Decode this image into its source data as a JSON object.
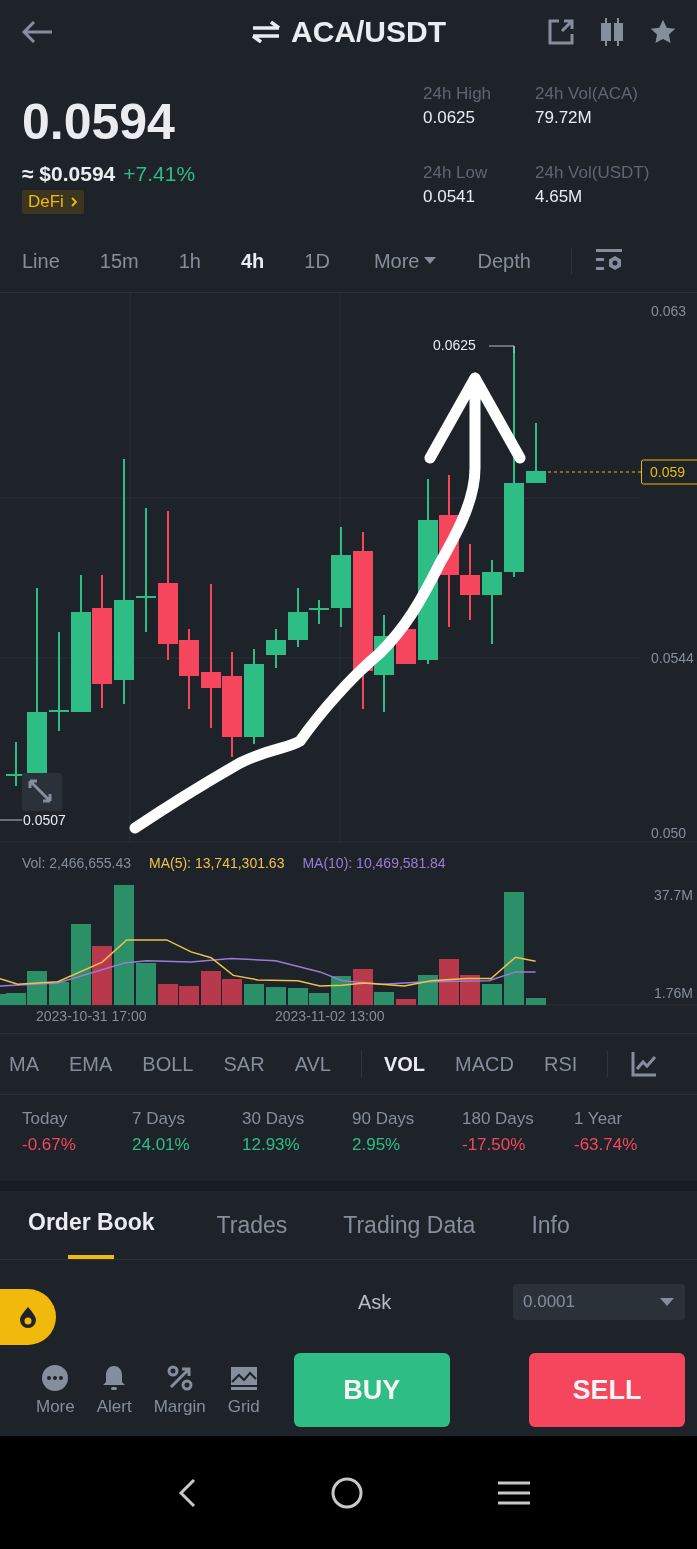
{
  "header": {
    "title": "ACA/USDT"
  },
  "price": {
    "last": "0.0594",
    "usd": "≈ $0.0594",
    "change": "+7.41%",
    "color": "#2ebd85",
    "tag": "DeFi"
  },
  "stats": [
    {
      "label": "24h High",
      "value": "0.0625"
    },
    {
      "label": "24h Vol(ACA)",
      "value": "79.72M"
    },
    {
      "label": "24h Low",
      "value": "0.0541"
    },
    {
      "label": "24h Vol(USDT)",
      "value": "4.65M"
    }
  ],
  "intervals": [
    {
      "label": "Line",
      "kind": "interval",
      "selected": false
    },
    {
      "label": "15m",
      "kind": "interval",
      "selected": false
    },
    {
      "label": "1h",
      "kind": "interval",
      "selected": false
    },
    {
      "label": "4h",
      "kind": "interval",
      "selected": true
    },
    {
      "label": "1D",
      "kind": "interval",
      "selected": false
    },
    {
      "label": "More",
      "kind": "menu",
      "selected": false
    },
    {
      "label": "Depth",
      "kind": "interval",
      "selected": false
    }
  ],
  "chart": {
    "price_ticks": [
      "0.063",
      "0.0544",
      "0.050"
    ],
    "high_label": "0.0625",
    "low_label": "0.0507",
    "last_price_tag": "0.059"
  },
  "volume": {
    "vol": "Vol: 2,466,655.43",
    "ma5": "MA(5): 13,741,301.63",
    "ma10": "MA(10): 10,469,581.84",
    "ticks": [
      "37.7M",
      "1.76M"
    ],
    "dates": [
      "2023-10-31 17:00",
      "2023-11-02 13:00"
    ]
  },
  "indicators": [
    {
      "label": "MA",
      "selected": false
    },
    {
      "label": "EMA",
      "selected": false
    },
    {
      "label": "BOLL",
      "selected": false
    },
    {
      "label": "SAR",
      "selected": false
    },
    {
      "label": "AVL",
      "selected": false
    },
    {
      "label": "VOL",
      "selected": true
    },
    {
      "label": "MACD",
      "selected": false
    },
    {
      "label": "RSI",
      "selected": false
    }
  ],
  "performance": [
    {
      "period": "Today",
      "change": "-0.67%",
      "color": "#f6465d"
    },
    {
      "period": "7 Days",
      "change": "24.01%",
      "color": "#2ebd85"
    },
    {
      "period": "30 Days",
      "change": "12.93%",
      "color": "#2ebd85"
    },
    {
      "period": "90 Days",
      "change": "2.95%",
      "color": "#2ebd85"
    },
    {
      "period": "180 Days",
      "change": "-17.50%",
      "color": "#f6465d"
    },
    {
      "period": "1 Year",
      "change": "-63.74%",
      "color": "#f6465d"
    }
  ],
  "tabs": [
    {
      "label": "Order Book",
      "selected": true
    },
    {
      "label": "Trades",
      "selected": false
    },
    {
      "label": "Trading Data",
      "selected": false
    },
    {
      "label": "Info",
      "selected": false
    }
  ],
  "order_book": {
    "side_label": "Ask",
    "precision": "0.0001"
  },
  "actions": [
    {
      "label": "More"
    },
    {
      "label": "Alert"
    },
    {
      "label": "Margin"
    },
    {
      "label": "Grid"
    }
  ],
  "buttons": {
    "buy": "BUY",
    "sell": "SELL"
  }
}
